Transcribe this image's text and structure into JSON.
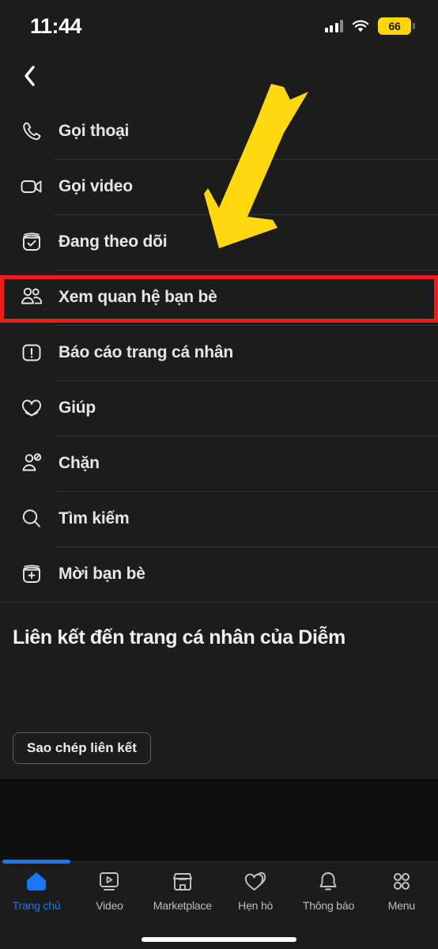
{
  "status_bar": {
    "time": "11:44",
    "signal_icon": "cellular-signal-icon",
    "wifi_icon": "wifi-icon",
    "battery_level": "66",
    "battery_color": "#ffd60a"
  },
  "nav": {
    "back_icon": "chevron-left-icon"
  },
  "menu": {
    "items": [
      {
        "label": "Gọi thoại",
        "icon": "phone-icon"
      },
      {
        "label": "Gọi video",
        "icon": "video-camera-icon"
      },
      {
        "label": "Đang theo dõi",
        "icon": "following-check-icon"
      },
      {
        "label": "Xem quan hệ bạn bè",
        "icon": "people-icon"
      },
      {
        "label": "Báo cáo trang cá nhân",
        "icon": "report-exclamation-icon"
      },
      {
        "label": "Giúp",
        "icon": "heart-support-icon"
      },
      {
        "label": "Chặn",
        "icon": "block-user-icon"
      },
      {
        "label": "Tìm kiếm",
        "icon": "search-icon"
      },
      {
        "label": "Mời bạn bè",
        "icon": "invite-plus-icon"
      }
    ]
  },
  "link_section": {
    "heading": "Liên kết đến trang cá nhân của Diễm",
    "copy_button": "Sao chép liên kết"
  },
  "tabbar": {
    "active_color": "#1877f2",
    "items": [
      {
        "label": "Trang chủ",
        "icon": "home-icon",
        "active": true
      },
      {
        "label": "Video",
        "icon": "video-play-icon",
        "active": false
      },
      {
        "label": "Marketplace",
        "icon": "storefront-icon",
        "active": false
      },
      {
        "label": "Hẹn hò",
        "icon": "dating-hearts-icon",
        "active": false
      },
      {
        "label": "Thông báo",
        "icon": "bell-icon",
        "active": false
      },
      {
        "label": "Menu",
        "icon": "grid-menu-icon",
        "active": false
      }
    ]
  },
  "annotations": {
    "highlight_box_color": "#f01c1c",
    "arrow_color": "#ffd90f",
    "highlight_target": "Xem quan hệ bạn bè"
  }
}
